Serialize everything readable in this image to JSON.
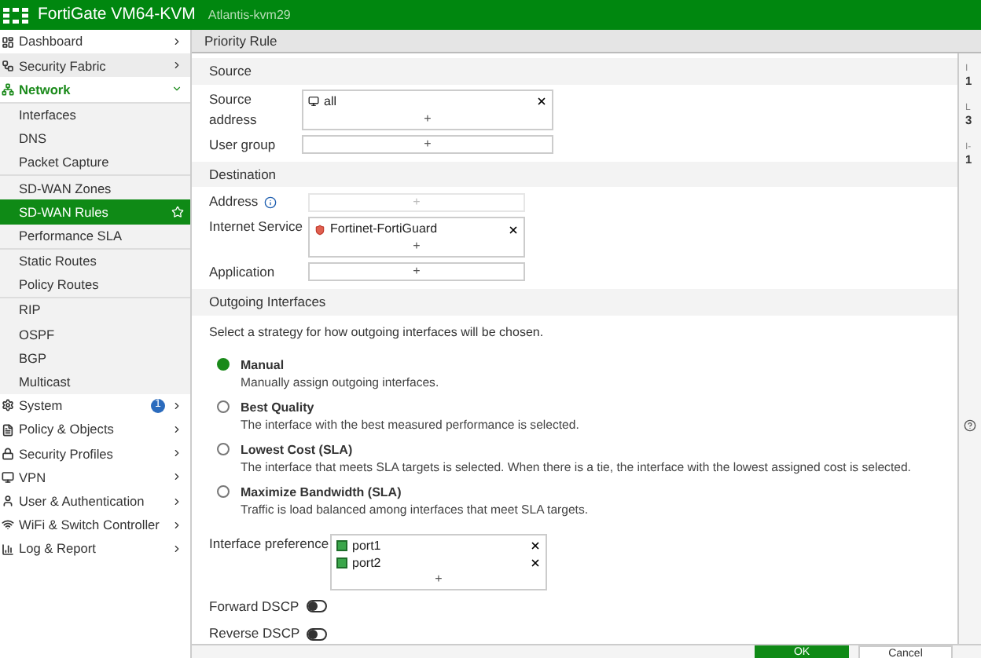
{
  "header": {
    "product": "FortiGate VM64-KVM",
    "hostname": "Atlantis-kvm29"
  },
  "sidebar": {
    "items": [
      {
        "label": "Dashboard",
        "expanded": false
      },
      {
        "label": "Security Fabric",
        "expanded": false
      },
      {
        "label": "Network",
        "expanded": true,
        "groups": [
          [
            {
              "label": "Interfaces",
              "selected": false
            },
            {
              "label": "DNS",
              "selected": false
            },
            {
              "label": "Packet Capture",
              "selected": false
            }
          ],
          [
            {
              "label": "SD-WAN Zones",
              "selected": false
            },
            {
              "label": "SD-WAN Rules",
              "selected": true
            },
            {
              "label": "Performance SLA",
              "selected": false
            }
          ],
          [
            {
              "label": "Static Routes",
              "selected": false
            },
            {
              "label": "Policy Routes",
              "selected": false
            }
          ],
          [
            {
              "label": "RIP",
              "selected": false
            },
            {
              "label": "OSPF",
              "selected": false
            },
            {
              "label": "BGP",
              "selected": false
            },
            {
              "label": "Multicast",
              "selected": false
            }
          ]
        ]
      },
      {
        "label": "System",
        "expanded": false,
        "badge": "1"
      },
      {
        "label": "Policy & Objects",
        "expanded": false
      },
      {
        "label": "Security Profiles",
        "expanded": false
      },
      {
        "label": "VPN",
        "expanded": false
      },
      {
        "label": "User & Authentication",
        "expanded": false
      },
      {
        "label": "WiFi & Switch Controller",
        "expanded": false
      },
      {
        "label": "Log & Report",
        "expanded": false
      }
    ]
  },
  "page_title": "Priority Rule",
  "source": {
    "heading": "Source",
    "source_address_label": "Source address",
    "source_address_values": [
      "all"
    ],
    "user_group_label": "User group",
    "add": "+"
  },
  "destination": {
    "heading": "Destination",
    "address_label": "Address",
    "address_add": "+",
    "internet_service_label": "Internet Service",
    "internet_service_values": [
      "Fortinet-FortiGuard"
    ],
    "internet_service_add": "+",
    "application_label": "Application",
    "application_add": "+"
  },
  "outgoing": {
    "heading": "Outgoing Interfaces",
    "intro": "Select a strategy for how outgoing interfaces will be chosen.",
    "strategies": [
      {
        "title": "Manual",
        "description": "Manually assign outgoing interfaces.",
        "selected": true
      },
      {
        "title": "Best Quality",
        "description": "The interface with the best measured performance is selected.",
        "selected": false
      },
      {
        "title": "Lowest Cost (SLA)",
        "description": "The interface that meets SLA targets is selected. When there is a tie, the interface with the lowest assigned cost is selected.",
        "selected": false
      },
      {
        "title": "Maximize Bandwidth (SLA)",
        "description": "Traffic is load balanced among interfaces that meet SLA targets.",
        "selected": false
      }
    ],
    "interface_preference_label": "Interface preference",
    "interfaces": [
      "port1",
      "port2"
    ],
    "interface_add": "+",
    "toggles": [
      {
        "label": "Forward DSCP",
        "on": false
      },
      {
        "label": "Reverse DSCP",
        "on": false
      }
    ]
  },
  "side_panel": [
    {
      "label": "I",
      "value": "1"
    },
    {
      "label": "L",
      "value": "3"
    },
    {
      "label": "I-",
      "value": "1"
    }
  ],
  "buttons": [
    "OK",
    "Cancel"
  ]
}
